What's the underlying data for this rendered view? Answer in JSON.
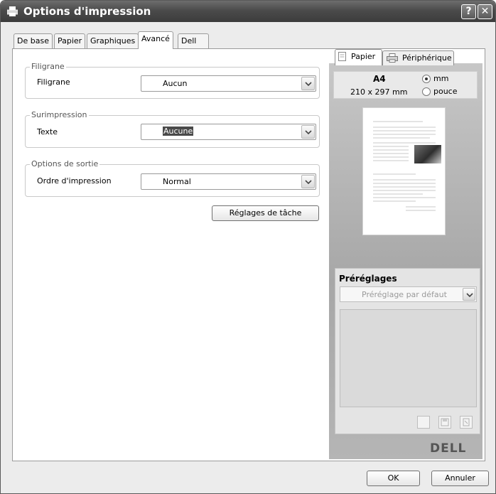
{
  "window": {
    "title": "Options d'impression",
    "help_label": "?",
    "close_label": "✕"
  },
  "tabs": [
    {
      "label": "De base",
      "active": false
    },
    {
      "label": "Papier",
      "active": false
    },
    {
      "label": "Graphiques",
      "active": false
    },
    {
      "label": "Avancé",
      "active": true
    },
    {
      "label": "Dell",
      "active": false
    }
  ],
  "groups": {
    "watermark": {
      "title": "Filigrane",
      "field_label": "Filigrane",
      "value": "Aucun"
    },
    "overlay": {
      "title": "Surimpression",
      "field_label": "Texte",
      "value": "Aucune"
    },
    "output": {
      "title": "Options de sortie",
      "field_label": "Ordre d'impression",
      "value": "Normal"
    }
  },
  "job_settings_button": "Réglages de tâche",
  "preview": {
    "tabs": [
      "Papier",
      "Périphérique"
    ],
    "active_tab": "Papier",
    "paper_name": "A4",
    "paper_dims": "210 x 297 mm",
    "units": [
      {
        "label": "mm",
        "checked": true
      },
      {
        "label": "pouce",
        "checked": false
      }
    ]
  },
  "presets": {
    "title": "Préréglages",
    "selected": "Préréglage par défaut"
  },
  "brand": "DELL",
  "footer": {
    "ok_label": "OK",
    "cancel_label": "Annuler"
  },
  "icons": [
    "printer-icon",
    "help-icon",
    "close-icon",
    "dropdown-arrow-icon",
    "paper-icon",
    "device-icon",
    "new-preset-icon",
    "save-preset-icon",
    "delete-preset-icon"
  ],
  "colors": {
    "titlebar": "#4b4b4b",
    "selection": "#4a4a4a",
    "panel": "#ececec"
  }
}
